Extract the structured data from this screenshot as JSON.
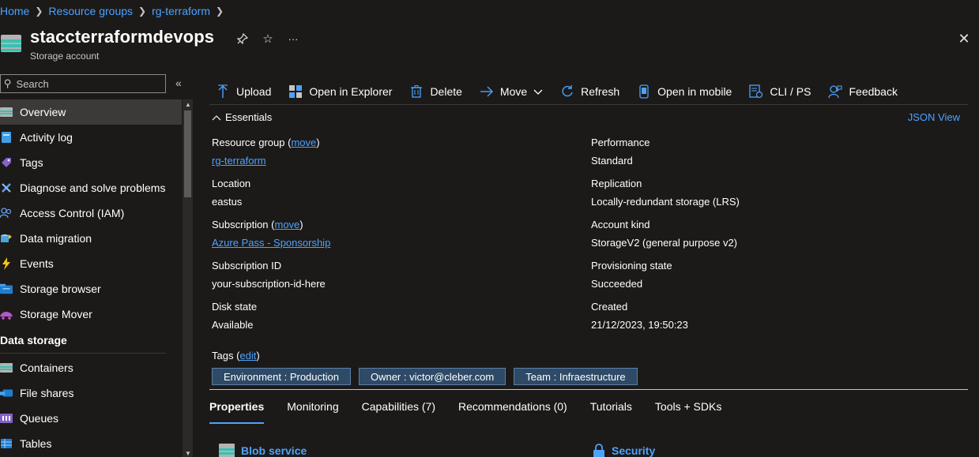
{
  "breadcrumb": [
    "Home",
    "Resource groups",
    "rg-terraform"
  ],
  "header": {
    "title": "staccterraformdevops",
    "subtitle": "Storage account",
    "more": "···"
  },
  "sidebar": {
    "search_placeholder": "Search",
    "collapse": "«",
    "items": [
      {
        "label": "Overview",
        "icon": "storage-icon"
      },
      {
        "label": "Activity log",
        "icon": "activity-log-icon"
      },
      {
        "label": "Tags",
        "icon": "tag-icon"
      },
      {
        "label": "Diagnose and solve problems",
        "icon": "wrench-icon"
      },
      {
        "label": "Access Control (IAM)",
        "icon": "people-icon"
      },
      {
        "label": "Data migration",
        "icon": "data-migration-icon"
      },
      {
        "label": "Events",
        "icon": "lightning-icon"
      },
      {
        "label": "Storage browser",
        "icon": "storage-browser-icon"
      },
      {
        "label": "Storage Mover",
        "icon": "storage-mover-icon"
      }
    ],
    "section": "Data storage",
    "section_items": [
      {
        "label": "Containers",
        "icon": "containers-icon"
      },
      {
        "label": "File shares",
        "icon": "file-shares-icon"
      },
      {
        "label": "Queues",
        "icon": "queues-icon"
      },
      {
        "label": "Tables",
        "icon": "tables-icon"
      }
    ]
  },
  "toolbar": {
    "upload": "Upload",
    "open_in_explorer": "Open in Explorer",
    "delete": "Delete",
    "move": "Move",
    "refresh": "Refresh",
    "open_in_mobile": "Open in mobile",
    "cli_ps": "CLI / PS",
    "feedback": "Feedback"
  },
  "essentials": {
    "title": "Essentials",
    "json_view": "JSON View",
    "move_link": "move",
    "left": {
      "resource_group_label": "Resource group",
      "resource_group_value": "rg-terraform",
      "location_label": "Location",
      "location_value": "eastus",
      "subscription_label": "Subscription",
      "subscription_value": "Azure Pass - Sponsorship",
      "subscription_id_label": "Subscription ID",
      "subscription_id_value": "your-subscription-id-here",
      "disk_state_label": "Disk state",
      "disk_state_value": "Available"
    },
    "right": {
      "performance_label": "Performance",
      "performance_value": "Standard",
      "replication_label": "Replication",
      "replication_value": "Locally-redundant storage (LRS)",
      "account_kind_label": "Account kind",
      "account_kind_value": "StorageV2 (general purpose v2)",
      "provisioning_label": "Provisioning state",
      "provisioning_value": "Succeeded",
      "created_label": "Created",
      "created_value": "21/12/2023, 19:50:23"
    }
  },
  "tags": {
    "label": "Tags",
    "edit": "edit",
    "chips": [
      "Environment : Production",
      "Owner : victor@cleber.com",
      "Team : Infraestructure"
    ]
  },
  "tabs": [
    "Properties",
    "Monitoring",
    "Capabilities (7)",
    "Recommendations (0)",
    "Tutorials",
    "Tools + SDKs"
  ],
  "sections": {
    "blob_service": "Blob service",
    "security": "Security"
  },
  "colors": {
    "background": "#1b1a19",
    "link": "#4ea2ff",
    "active_nav": "#3b3a39",
    "tag_chip": "#2e4a66"
  }
}
